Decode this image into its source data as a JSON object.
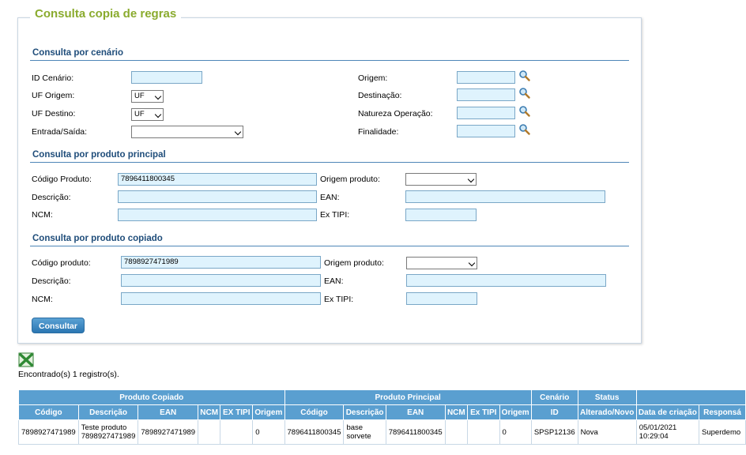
{
  "panel_title": "Consulta copia de regras",
  "cenario": {
    "title": "Consulta por cenário",
    "id_cenario_label": "ID Cenário:",
    "id_cenario_value": "",
    "uf_origem_label": "UF Origem:",
    "uf_origem_value": "UF",
    "uf_destino_label": "UF Destino:",
    "uf_destino_value": "UF",
    "entrada_saida_label": "Entrada/Saída:",
    "entrada_saida_value": "",
    "origem_label": "Origem:",
    "destinacao_label": "Destinação:",
    "natureza_label": "Natureza Operação:",
    "finalidade_label": "Finalidade:"
  },
  "principal": {
    "title": "Consulta por produto principal",
    "codigo_label": "Código Produto:",
    "codigo_value": "7896411800345",
    "descricao_label": "Descrição:",
    "ncm_label": "NCM:",
    "origem_label": "Origem produto:",
    "ean_label": "EAN:",
    "extipi_label": "Ex TIPI:"
  },
  "copiado": {
    "title": "Consulta por produto copiado",
    "codigo_label": "Código produto:",
    "codigo_value": "7898927471989",
    "descricao_label": "Descrição:",
    "ncm_label": "NCM:",
    "origem_label": "Origem produto:",
    "ean_label": "EAN:",
    "extipi_label": "Ex TIPI:"
  },
  "consultar_label": "Consultar",
  "found_text": "Encontrado(s) 1 registro(s).",
  "table": {
    "groups": {
      "copiado": "Produto Copiado",
      "principal": "Produto Principal",
      "cenario": "Cenário",
      "status": "Status"
    },
    "headers": [
      "Código",
      "Descrição",
      "EAN",
      "NCM",
      "EX TIPI",
      "Origem",
      "Código",
      "Descrição",
      "EAN",
      "NCM",
      "Ex TIPI",
      "Origem",
      "ID",
      "Alterado/Novo",
      "Data de criação",
      "Responsá"
    ],
    "row": {
      "cp_codigo": "7898927471989",
      "cp_descricao_1": "Teste produto",
      "cp_descricao_2": "7898927471989",
      "cp_ean": "7898927471989",
      "cp_ncm": "",
      "cp_extipi": "",
      "cp_origem": "0",
      "pp_codigo": "7896411800345",
      "pp_descricao_1": "base",
      "pp_descricao_2": "sorvete",
      "pp_ean": "7896411800345",
      "pp_ncm": "",
      "pp_extipi": "",
      "pp_origem": "0",
      "cen_id": "SPSP12136",
      "status": "Nova",
      "data_1": "05/01/2021",
      "data_2": "10:29:04",
      "responsavel": "Superdemo"
    }
  },
  "colors": {
    "title_green": "#8aab2e",
    "section_blue": "#1f4d7a",
    "header_blue": "#5a9fd0",
    "input_bg": "#dff3fd"
  },
  "icons": [
    "magnifier-icon",
    "excel-icon"
  ]
}
